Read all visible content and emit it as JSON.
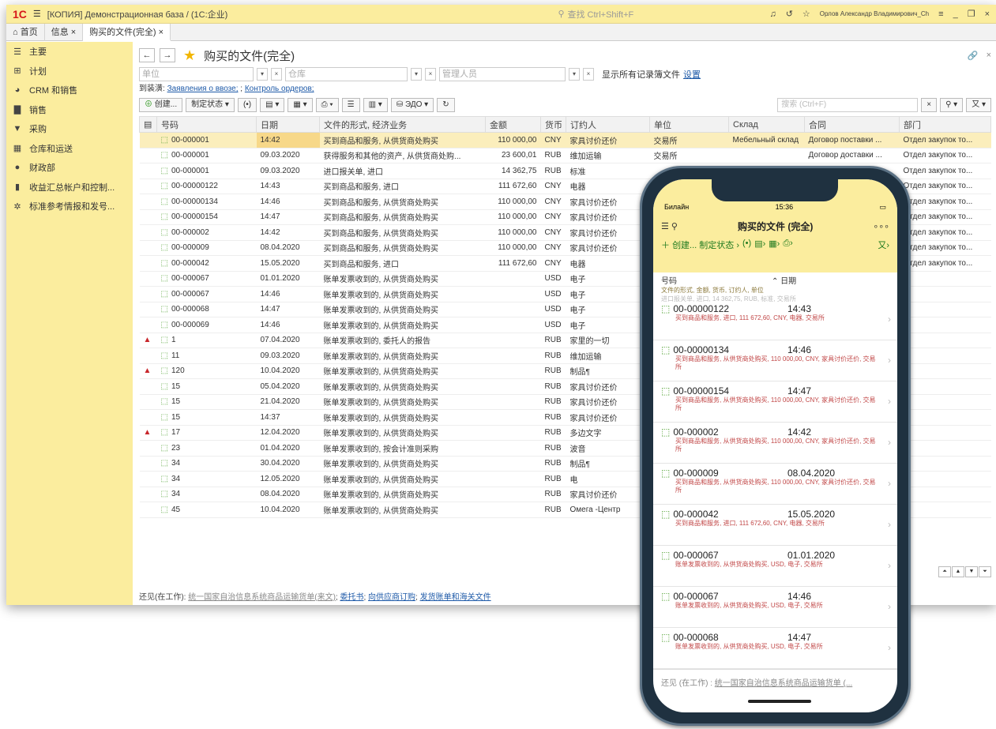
{
  "app": {
    "logo": "1C",
    "title": "[КОПИЯ] Демонстрационная база / (1С:企业)",
    "search": "查找 Ctrl+Shift+F",
    "user": "Орлов Александр Владимирович_Ch"
  },
  "tabs": [
    "首页",
    "信息 ×",
    "购买的文件(完全) ×"
  ],
  "sidebar": [
    "主要",
    "计划",
    "CRM 和销售",
    "销售",
    "采购",
    "仓库和运送",
    "财政部",
    "收益汇总帐户和控制...",
    "标准参考情报和发号..."
  ],
  "header": {
    "title": "购买的文件(完全)"
  },
  "filters": {
    "unit": "单位",
    "warehouse": "仓库",
    "manager": "管理人员",
    "show_all": "显示所有记录簿文件",
    "settings": "设置"
  },
  "subline": {
    "prefix": "到装潢:",
    "link1": "Заявления о ввозе;",
    "sep": ";",
    "link2": "Контроль ордеров;"
  },
  "toolbar": {
    "create": "创建...",
    "status": "制定状态",
    "edo": "ЭДО",
    "search": "搜索 (Ctrl+F)"
  },
  "columns": [
    "号码",
    "日期",
    "文件的形式, 经济业务",
    "金额",
    "货币",
    "订约人",
    "单位",
    "Склад",
    "合同",
    "部门"
  ],
  "rows": [
    {
      "n": "00-000001",
      "d": "14:42",
      "t": "买到商品和服务, 从供货商处购买",
      "s": "110 000,00",
      "c": "CNY",
      "p": "家具讨价还价",
      "u": "交易所",
      "w": "Мебельный склад",
      "k": "Договор поставки ...",
      "dep": "Отдел закупок то...",
      "sel": true
    },
    {
      "n": "00-000001",
      "d": "09.03.2020",
      "t": "获得服务和其他的资产, 从供货商处购...",
      "s": "23 600,01",
      "c": "RUB",
      "p": "维加运输",
      "u": "交易所",
      "w": "",
      "k": "Договор доставки ...",
      "dep": "Отдел закупок то..."
    },
    {
      "n": "00-000001",
      "d": "09.03.2020",
      "t": "进口报关单, 进口",
      "s": "14 362,75",
      "c": "RUB",
      "p": "标准",
      "u": "",
      "w": "",
      "k": "",
      "dep": "Отдел закупок то..."
    },
    {
      "n": "00-00000122",
      "d": "14:43",
      "t": "买到商品和服务, 进口",
      "s": "111 672,60",
      "c": "CNY",
      "p": "电器",
      "u": "",
      "w": "",
      "k": "",
      "dep": "Отдел закупок то..."
    },
    {
      "n": "00-00000134",
      "d": "14:46",
      "t": "买到商品和服务, 从供货商处购买",
      "s": "110 000,00",
      "c": "CNY",
      "p": "家具讨价还价",
      "u": "",
      "w": "",
      "k": "",
      "dep": "Отдел закупок то..."
    },
    {
      "n": "00-00000154",
      "d": "14:47",
      "t": "买到商品和服务, 从供货商处购买",
      "s": "110 000,00",
      "c": "CNY",
      "p": "家具讨价还价",
      "u": "",
      "w": "",
      "k": "",
      "dep": "Отдел закупок то..."
    },
    {
      "n": "00-000002",
      "d": "14:42",
      "t": "买到商品和服务, 从供货商处购买",
      "s": "110 000,00",
      "c": "CNY",
      "p": "家具讨价还价",
      "u": "",
      "w": "",
      "k": "",
      "dep": "Отдел закупок то..."
    },
    {
      "n": "00-000009",
      "d": "08.04.2020",
      "t": "买到商品和服务, 从供货商处购买",
      "s": "110 000,00",
      "c": "CNY",
      "p": "家具讨价还价",
      "u": "",
      "w": "",
      "k": "",
      "dep": "Отдел закупок то..."
    },
    {
      "n": "00-000042",
      "d": "15.05.2020",
      "t": "买到商品和服务, 进口",
      "s": "111 672,60",
      "c": "CNY",
      "p": "电器",
      "u": "",
      "w": "",
      "k": "",
      "dep": "Отдел закупок то..."
    },
    {
      "n": "00-000067",
      "d": "01.01.2020",
      "t": "账单发票收到的, 从供货商处购买",
      "s": "",
      "c": "USD",
      "p": "电子",
      "u": "",
      "w": "",
      "k": "",
      "dep": ""
    },
    {
      "n": "00-000067",
      "d": "14:46",
      "t": "账单发票收到的, 从供货商处购买",
      "s": "",
      "c": "USD",
      "p": "电子",
      "u": "",
      "w": "",
      "k": "",
      "dep": ""
    },
    {
      "n": "00-000068",
      "d": "14:47",
      "t": "账单发票收到的, 从供货商处购买",
      "s": "",
      "c": "USD",
      "p": "电子",
      "u": "",
      "w": "",
      "k": "",
      "dep": ""
    },
    {
      "n": "00-000069",
      "d": "14:46",
      "t": "账单发票收到的, 从供货商处购买",
      "s": "",
      "c": "USD",
      "p": "电子",
      "u": "",
      "w": "",
      "k": "",
      "dep": ""
    },
    {
      "n": "1",
      "d": "07.04.2020",
      "t": "账单发票收到的, 委托人的报告",
      "s": "",
      "c": "RUB",
      "p": "家里的一切",
      "u": "",
      "w": "",
      "k": "",
      "dep": "",
      "warn": true
    },
    {
      "n": "11",
      "d": "09.03.2020",
      "t": "账单发票收到的, 从供货商处购买",
      "s": "",
      "c": "RUB",
      "p": "维加运输",
      "u": "",
      "w": "",
      "k": "",
      "dep": ""
    },
    {
      "n": "120",
      "d": "10.04.2020",
      "t": "账单发票收到的, 从供货商处购买",
      "s": "",
      "c": "RUB",
      "p": "制品¶",
      "u": "",
      "w": "",
      "k": "",
      "dep": "",
      "warn": true
    },
    {
      "n": "15",
      "d": "05.04.2020",
      "t": "账单发票收到的, 从供货商处购买",
      "s": "",
      "c": "RUB",
      "p": "家具讨价还价",
      "u": "",
      "w": "",
      "k": "",
      "dep": ""
    },
    {
      "n": "15",
      "d": "21.04.2020",
      "t": "账单发票收到的, 从供货商处购买",
      "s": "",
      "c": "RUB",
      "p": "家具讨价还价",
      "u": "",
      "w": "",
      "k": "",
      "dep": ""
    },
    {
      "n": "15",
      "d": "14:37",
      "t": "账单发票收到的, 从供货商处购买",
      "s": "",
      "c": "RUB",
      "p": "家具讨价还价",
      "u": "",
      "w": "",
      "k": "",
      "dep": ""
    },
    {
      "n": "17",
      "d": "12.04.2020",
      "t": "账单发票收到的, 从供货商处购买",
      "s": "",
      "c": "RUB",
      "p": "多边文字",
      "u": "",
      "w": "",
      "k": "",
      "dep": "",
      "warn": true
    },
    {
      "n": "23",
      "d": "01.04.2020",
      "t": "账单发票收到的, 按会计准则采购",
      "s": "",
      "c": "RUB",
      "p": "波音",
      "u": "",
      "w": "",
      "k": "",
      "dep": ""
    },
    {
      "n": "34",
      "d": "30.04.2020",
      "t": "账单发票收到的, 从供货商处购买",
      "s": "",
      "c": "RUB",
      "p": "制品¶",
      "u": "",
      "w": "",
      "k": "",
      "dep": ""
    },
    {
      "n": "34",
      "d": "12.05.2020",
      "t": "账单发票收到的, 从供货商处购买",
      "s": "",
      "c": "RUB",
      "p": "电",
      "u": "",
      "w": "",
      "k": "",
      "dep": ""
    },
    {
      "n": "34",
      "d": "08.04.2020",
      "t": "账单发票收到的, 从供货商处购买",
      "s": "",
      "c": "RUB",
      "p": "家具讨价还价",
      "u": "",
      "w": "",
      "k": "",
      "dep": ""
    },
    {
      "n": "45",
      "d": "10.04.2020",
      "t": "账单发票收到的, 从供货商处购买",
      "s": "",
      "c": "RUB",
      "p": "Омега -Центр",
      "u": "",
      "w": "",
      "k": "",
      "dep": ""
    }
  ],
  "footer": {
    "prefix": "还见(在工作):",
    "l1": "统一国家自治信息系统商品运输货单(来文)",
    "l2": "委托书",
    "l3": "向供应商订购",
    "l4": "发货账单和海关文件"
  },
  "phone": {
    "carrier": "Билайн",
    "time": "15:36",
    "title": "购买的文件 (完全)",
    "tools": "创建... 制定状态 ›",
    "col1": "号码",
    "col2": "日期",
    "colsub": "文件的形式, 金额, 货币, 订约人, 单位",
    "top_line": "进口报关单, 进口, 14 362,75, RUB, 标准, 交易所",
    "items": [
      {
        "n": "00-00000122",
        "d": "14:43",
        "l": "买到商品和服务, 进口, 111 672,60, CNY, 电器, 交易所"
      },
      {
        "n": "00-00000134",
        "d": "14:46",
        "l": "买到商品和服务, 从供货商处购买, 110 000,00, CNY, 家具讨价还价, 交易所"
      },
      {
        "n": "00-00000154",
        "d": "14:47",
        "l": "买到商品和服务, 从供货商处购买, 110 000,00, CNY, 家具讨价还价, 交易所"
      },
      {
        "n": "00-000002",
        "d": "14:42",
        "l": "买到商品和服务, 从供货商处购买, 110 000,00, CNY, 家具讨价还价, 交易所"
      },
      {
        "n": "00-000009",
        "d": "08.04.2020",
        "l": "买到商品和服务, 从供货商处购买, 110 000,00, CNY, 家具讨价还价, 交易所"
      },
      {
        "n": "00-000042",
        "d": "15.05.2020",
        "l": "买到商品和服务, 进口, 111 672,60, CNY, 电器, 交易所"
      },
      {
        "n": "00-000067",
        "d": "01.01.2020",
        "l": "账单发票收到的, 从供货商处购买, USD, 电子, 交易所"
      },
      {
        "n": "00-000067",
        "d": "14:46",
        "l": "账单发票收到的, 从供货商处购买, USD, 电子, 交易所"
      },
      {
        "n": "00-000068",
        "d": "14:47",
        "l": "账单发票收到的, 从供货商处购买, USD, 电子, 交易所"
      }
    ],
    "footer": "还见 (在工作) :",
    "footer_link": "统一国家自治信息系统商品运输货单 (..."
  }
}
